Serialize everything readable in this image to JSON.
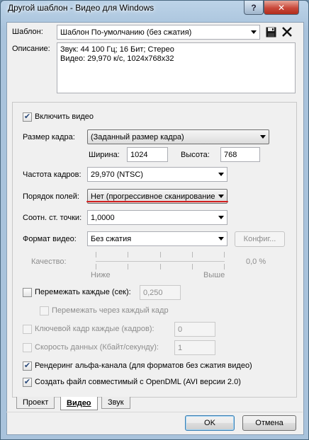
{
  "window": {
    "title": "Другой шаблон - Видео для Windows",
    "help_button": "?",
    "close_button": "✕"
  },
  "template": {
    "label": "Шаблон:",
    "value": "Шаблон По-умолчанию (без сжатия)"
  },
  "description": {
    "label": "Описание:",
    "line1": "Звук: 44 100 Гц; 16 Бит; Стерео",
    "line2": "Видео: 29,970 к/с, 1024x768x32"
  },
  "video": {
    "enable_label": "Включить видео",
    "enable_checked": true,
    "frame_size_label": "Размер кадра:",
    "frame_size_value": "(Заданный размер кадра)",
    "width_label": "Ширина:",
    "width_value": "1024",
    "height_label": "Высота:",
    "height_value": "768",
    "frame_rate_label": "Частота кадров:",
    "frame_rate_value": "29,970 (NTSC)",
    "field_order_label": "Порядок полей:",
    "field_order_value": "Нет (прогрессивное сканирование",
    "pixel_aspect_label": "Соотн. ст. точки:",
    "pixel_aspect_value": "1,0000",
    "format_label": "Формат видео:",
    "format_value": "Без сжатия",
    "config_button": "Конфиг...",
    "quality_label": "Качество:",
    "quality_value": "0,0 %",
    "quality_low": "Ниже",
    "quality_high": "Выше",
    "interleave_label": "Перемежать каждые (сек):",
    "interleave_value": "0,250",
    "interleave_each_frame_label": "Перемежать через каждый кадр",
    "keyframe_label": "Ключевой кадр каждые (кадров):",
    "keyframe_value": "0",
    "datarate_label": "Скорость данных (Кбайт/секунду):",
    "datarate_value": "1",
    "alpha_label": "Рендеринг альфа-канала (для форматов без сжатия видео)",
    "alpha_checked": true,
    "opendml_label": "Создать файл совместимый с OpenDML (AVI версии 2.0)",
    "opendml_checked": true
  },
  "tabs": [
    {
      "label": "Проект"
    },
    {
      "label": "Видео"
    },
    {
      "label": "Звук"
    }
  ],
  "buttons": {
    "ok": "OK",
    "cancel": "Отмена"
  },
  "colors": {
    "annotation_underline": "#d32020",
    "title_bar": "#a9c3dc"
  }
}
